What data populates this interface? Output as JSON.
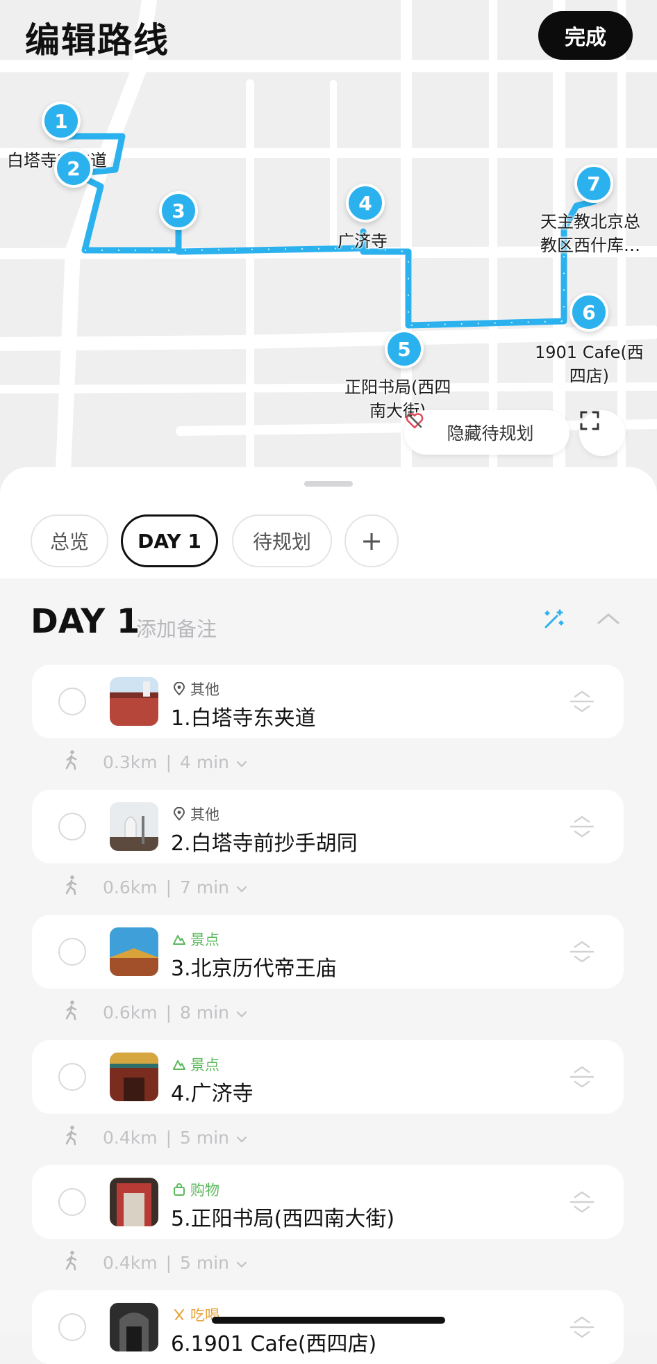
{
  "header": {
    "title": "编辑路线",
    "done_label": "完成"
  },
  "map": {
    "markers": [
      "1",
      "2",
      "3",
      "4",
      "5",
      "6",
      "7"
    ],
    "labels": {
      "p1": "白塔寺东夹道",
      "p4": "广济寺",
      "p5_line1": "正阳书局(西四",
      "p5_line2": "南大街)",
      "p6_line1": "1901 Cafe(西",
      "p6_line2": "四店)",
      "p7_line1": "天主教北京总",
      "p7_line2": "教区西什库…"
    },
    "hide_unplanned_label": "隐藏待规划",
    "route_color": "#2bb2ee"
  },
  "tabs": [
    "总览",
    "DAY 1",
    "待规划",
    "+"
  ],
  "active_tab": "DAY 1",
  "day": {
    "title": "DAY 1",
    "note_placeholder": "添加备注"
  },
  "stops": [
    {
      "category": "其他",
      "category_color": "#555555",
      "name": "1.白塔寺东夹道"
    },
    {
      "category": "其他",
      "category_color": "#555555",
      "name": "2.白塔寺前抄手胡同"
    },
    {
      "category": "景点",
      "category_color": "#5cb85c",
      "name": "3.北京历代帝王庙"
    },
    {
      "category": "景点",
      "category_color": "#5cb85c",
      "name": "4.广济寺"
    },
    {
      "category": "购物",
      "category_color": "#5cb85c",
      "name": "5.正阳书局(西四南大街)"
    },
    {
      "category": "吃喝",
      "category_color": "#e5a33a",
      "name": "6.1901 Cafe(西四店)"
    }
  ],
  "legs": [
    {
      "distance": "0.3km",
      "duration": "4 min"
    },
    {
      "distance": "0.6km",
      "duration": "7 min"
    },
    {
      "distance": "0.6km",
      "duration": "8 min"
    },
    {
      "distance": "0.4km",
      "duration": "5 min"
    },
    {
      "distance": "0.4km",
      "duration": "5 min"
    }
  ]
}
